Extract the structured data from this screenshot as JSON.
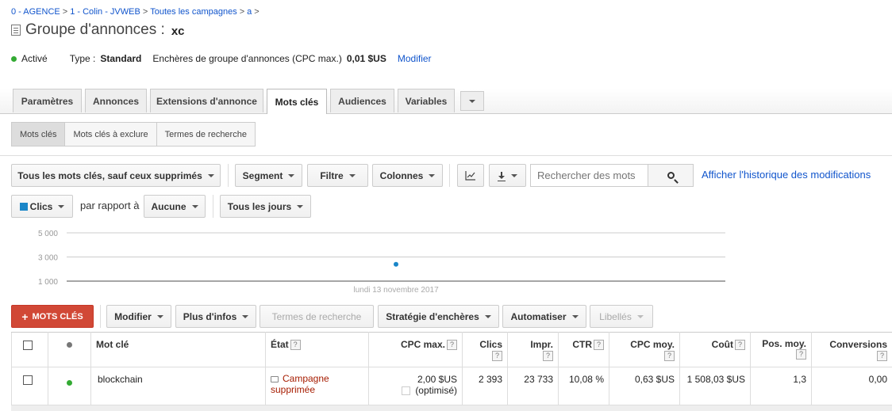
{
  "breadcrumb": {
    "items": [
      "0 - AGENCE",
      "1 - Colin - JVWEB",
      "Toutes les campagnes",
      "a"
    ],
    "sep": ">"
  },
  "header": {
    "label": "Groupe d'annonces :",
    "name": "xc"
  },
  "status": {
    "state": "Activé",
    "type_label": "Type :",
    "type_value": "Standard",
    "bid_label": "Enchères de groupe d'annonces (CPC max.)",
    "bid_value": "0,01 $US",
    "modify": "Modifier"
  },
  "tabs": [
    {
      "label": "Paramètres"
    },
    {
      "label": "Annonces"
    },
    {
      "label": "Extensions d'annonce"
    },
    {
      "label": "Mots clés",
      "active": true
    },
    {
      "label": "Audiences"
    },
    {
      "label": "Variables"
    }
  ],
  "subtabs": [
    {
      "label": "Mots clés",
      "active": true
    },
    {
      "label": "Mots clés à exclure"
    },
    {
      "label": "Termes de recherche"
    }
  ],
  "toolbar": {
    "filter_all": "Tous les mots clés, sauf ceux supprimés",
    "segment": "Segment",
    "filtre": "Filtre",
    "colonnes": "Colonnes",
    "search_placeholder": "Rechercher des mots",
    "history": "Afficher l'historique des modifications",
    "metric": "Clics",
    "compare_label": "par rapport à",
    "compare_value": "Aucune",
    "period": "Tous les jours"
  },
  "chart_data": {
    "type": "scatter",
    "yticks": [
      "5 000",
      "3 000",
      "1 000"
    ],
    "ylim": [
      0,
      5000
    ],
    "x": [
      "lundi 13 novembre 2017"
    ],
    "series": [
      {
        "values": [
          2393
        ]
      }
    ],
    "xlabel": "lundi 13 novembre 2017",
    "grid": true,
    "color": "#1a86c8"
  },
  "actions": {
    "add": "MOTS CLÉS",
    "modifier": "Modifier",
    "plus_infos": "Plus d'infos",
    "termes": "Termes de recherche",
    "strategie": "Stratégie d'enchères",
    "automatiser": "Automatiser",
    "libelles": "Libellés"
  },
  "table": {
    "columns": {
      "keyword": "Mot clé",
      "state": "État",
      "cpc_max": "CPC max.",
      "clics": "Clics",
      "impr": "Impr.",
      "ctr": "CTR",
      "cpc_moy": "CPC moy.",
      "cout": "Coût",
      "pos_moy": "Pos. moy.",
      "conversions": "Conversions"
    },
    "help": "?",
    "rows": [
      {
        "keyword": "blockchain",
        "state": "Campagne supprimée",
        "cpc_max": "2,00 $US",
        "cpc_note": "(optimisé)",
        "clics": "2 393",
        "impr": "23 733",
        "ctr": "10,08 %",
        "cpc_moy": "0,63 $US",
        "cout": "1 508,03 $US",
        "pos_moy": "1,3",
        "conversions": "0,00"
      }
    ]
  },
  "colors": {
    "link": "#1155cc",
    "accent_red": "#d14836",
    "series": "#1a86c8",
    "status_green": "#33aa33"
  }
}
